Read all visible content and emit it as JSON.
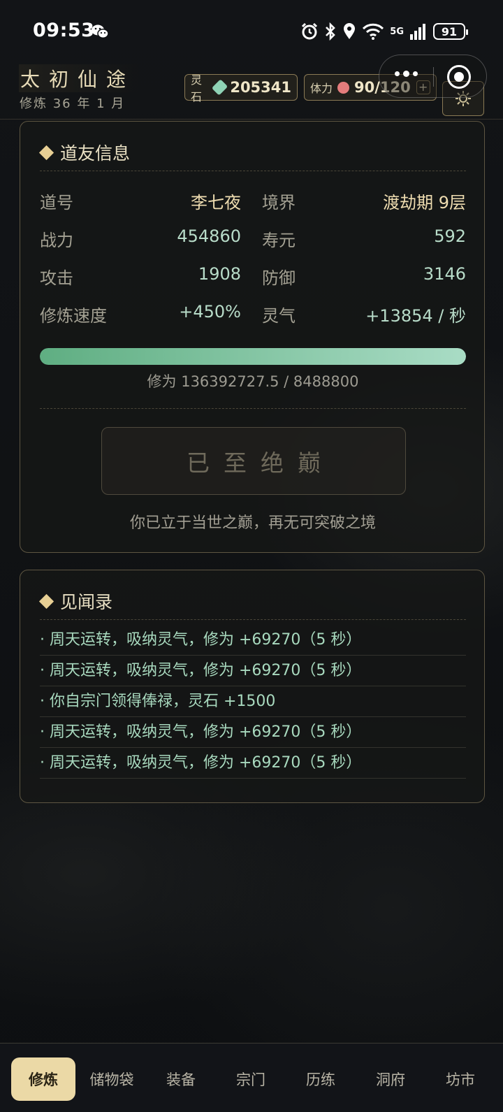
{
  "status_bar": {
    "time": "09:53",
    "network": "5G",
    "battery": "91"
  },
  "header": {
    "title": "太初仙途",
    "subtitle": "修炼 36 年 1 月",
    "spirit_stone": {
      "label": "灵石",
      "value": "205341"
    },
    "stamina": {
      "label": "体力",
      "value": "90/120",
      "plus": "+"
    }
  },
  "info_panel": {
    "title": "道友信息",
    "rows": [
      {
        "k1": "道号",
        "v1": "李七夜",
        "k2": "境界",
        "v2": "渡劫期 9层"
      },
      {
        "k1": "战力",
        "v1": "454860",
        "k2": "寿元",
        "v2": "592"
      },
      {
        "k1": "攻击",
        "v1": "1908",
        "k2": "防御",
        "v2": "3146"
      },
      {
        "k1": "修炼速度",
        "v1": "+450%",
        "k2": "灵气",
        "v2": "+13854 / 秒"
      }
    ],
    "progress_fraction": 1.0,
    "progress_text": "修为 136392727.5 / 8488800",
    "button_label": "已至绝巅",
    "note": "你已立于当世之巅，再无可突破之境"
  },
  "log_panel": {
    "title": "见闻录",
    "items": [
      "· 周天运转，吸纳灵气，修为 +69270（5 秒）",
      "· 周天运转，吸纳灵气，修为 +69270（5 秒）",
      "· 你自宗门领得俸禄，灵石 +1500",
      "· 周天运转，吸纳灵气，修为 +69270（5 秒）",
      "· 周天运转，吸纳灵气，修为 +69270（5 秒）"
    ]
  },
  "nav": {
    "items": [
      "修炼",
      "储物袋",
      "装备",
      "宗门",
      "历练",
      "洞府",
      "坊市"
    ],
    "active": "修炼"
  },
  "colors": {
    "accent": "#ebd9a6",
    "value_green": "#b8dcc9",
    "border": "#5e5642"
  }
}
